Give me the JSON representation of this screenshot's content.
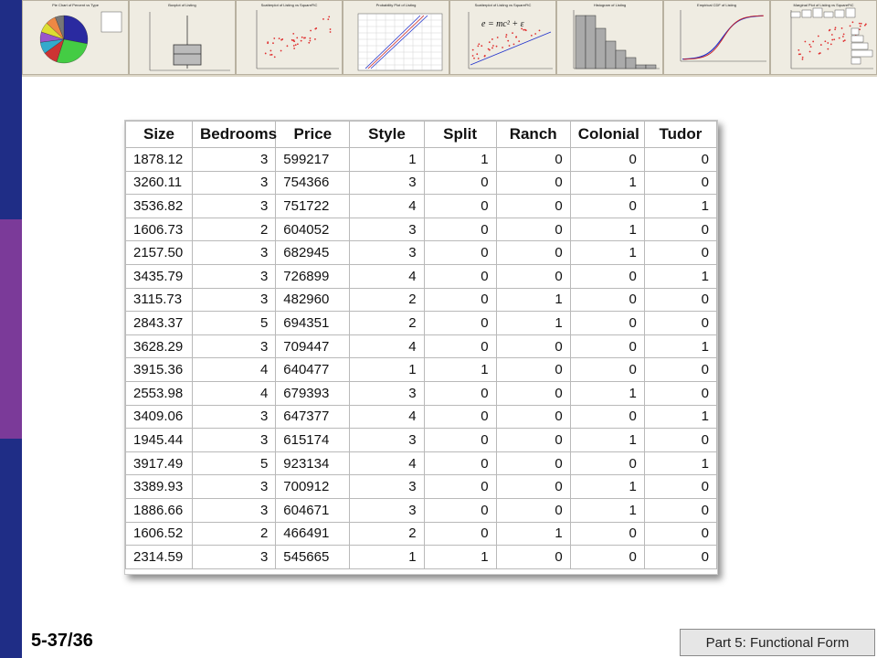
{
  "colors": {
    "left_bar_top": "#1f2d86",
    "left_bar_mid": "#7b3a99",
    "strip_bg": "#dcd6c6",
    "scatter_red": "#e03030",
    "line_blue": "#2233cc"
  },
  "thumbnails": [
    {
      "title": "Pie Chart of Percent vs Type",
      "icon": "pie-chart-thumbnail"
    },
    {
      "title": "Boxplot of Listing",
      "icon": "boxplot-thumbnail"
    },
    {
      "title": "Scatterplot of Listing vs SquareFtC",
      "icon": "scatterplot-thumbnail"
    },
    {
      "title": "Probability Plot of Listing",
      "icon": "probability-plot-thumbnail"
    },
    {
      "title": "Scatterplot of Listing vs SquareFtC",
      "icon": "regression-scatter-thumbnail",
      "formula": "e = mc² + ε"
    },
    {
      "title": "Histogram of Listing",
      "icon": "histogram-thumbnail"
    },
    {
      "title": "Empirical CDF of Listing",
      "icon": "ecdf-thumbnail"
    },
    {
      "title": "Marginal Plot of Listing vs SquareFtC",
      "icon": "marginal-plot-thumbnail"
    }
  ],
  "table": {
    "headers": [
      "Size",
      "Bedrooms",
      "Price",
      "Style",
      "Split",
      "Ranch",
      "Colonial",
      "Tudor"
    ],
    "rows": [
      [
        "1878.12",
        "3",
        "599217",
        "1",
        "1",
        "0",
        "0",
        "0"
      ],
      [
        "3260.11",
        "3",
        "754366",
        "3",
        "0",
        "0",
        "1",
        "0"
      ],
      [
        "3536.82",
        "3",
        "751722",
        "4",
        "0",
        "0",
        "0",
        "1"
      ],
      [
        "1606.73",
        "2",
        "604052",
        "3",
        "0",
        "0",
        "1",
        "0"
      ],
      [
        "2157.50",
        "3",
        "682945",
        "3",
        "0",
        "0",
        "1",
        "0"
      ],
      [
        "3435.79",
        "3",
        "726899",
        "4",
        "0",
        "0",
        "0",
        "1"
      ],
      [
        "3115.73",
        "3",
        "482960",
        "2",
        "0",
        "1",
        "0",
        "0"
      ],
      [
        "2843.37",
        "5",
        "694351",
        "2",
        "0",
        "1",
        "0",
        "0"
      ],
      [
        "3628.29",
        "3",
        "709447",
        "4",
        "0",
        "0",
        "0",
        "1"
      ],
      [
        "3915.36",
        "4",
        "640477",
        "1",
        "1",
        "0",
        "0",
        "0"
      ],
      [
        "2553.98",
        "4",
        "679393",
        "3",
        "0",
        "0",
        "1",
        "0"
      ],
      [
        "3409.06",
        "3",
        "647377",
        "4",
        "0",
        "0",
        "0",
        "1"
      ],
      [
        "1945.44",
        "3",
        "615174",
        "3",
        "0",
        "0",
        "1",
        "0"
      ],
      [
        "3917.49",
        "5",
        "923134",
        "4",
        "0",
        "0",
        "0",
        "1"
      ],
      [
        "3389.93",
        "3",
        "700912",
        "3",
        "0",
        "0",
        "1",
        "0"
      ],
      [
        "1886.66",
        "3",
        "604671",
        "3",
        "0",
        "0",
        "1",
        "0"
      ],
      [
        "1606.52",
        "2",
        "466491",
        "2",
        "0",
        "1",
        "0",
        "0"
      ],
      [
        "2314.59",
        "3",
        "545665",
        "1",
        "1",
        "0",
        "0",
        "0"
      ]
    ]
  },
  "footer": {
    "slide_number": "5-37/36",
    "section": "Part 5: Functional Form"
  }
}
